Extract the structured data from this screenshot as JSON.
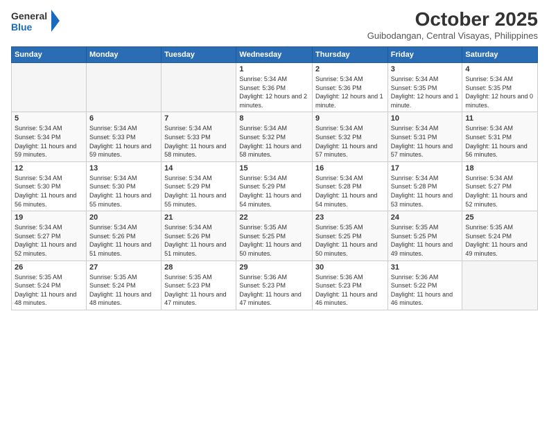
{
  "header": {
    "logo_general": "General",
    "logo_blue": "Blue",
    "month": "October 2025",
    "location": "Guibodangan, Central Visayas, Philippines"
  },
  "weekdays": [
    "Sunday",
    "Monday",
    "Tuesday",
    "Wednesday",
    "Thursday",
    "Friday",
    "Saturday"
  ],
  "weeks": [
    [
      {
        "day": "",
        "info": ""
      },
      {
        "day": "",
        "info": ""
      },
      {
        "day": "",
        "info": ""
      },
      {
        "day": "1",
        "sunrise": "5:34 AM",
        "sunset": "5:36 PM",
        "daylight": "12 hours and 2 minutes."
      },
      {
        "day": "2",
        "sunrise": "5:34 AM",
        "sunset": "5:36 PM",
        "daylight": "12 hours and 1 minute."
      },
      {
        "day": "3",
        "sunrise": "5:34 AM",
        "sunset": "5:35 PM",
        "daylight": "12 hours and 1 minute."
      },
      {
        "day": "4",
        "sunrise": "5:34 AM",
        "sunset": "5:35 PM",
        "daylight": "12 hours and 0 minutes."
      }
    ],
    [
      {
        "day": "5",
        "sunrise": "5:34 AM",
        "sunset": "5:34 PM",
        "daylight": "11 hours and 59 minutes."
      },
      {
        "day": "6",
        "sunrise": "5:34 AM",
        "sunset": "5:33 PM",
        "daylight": "11 hours and 59 minutes."
      },
      {
        "day": "7",
        "sunrise": "5:34 AM",
        "sunset": "5:33 PM",
        "daylight": "11 hours and 58 minutes."
      },
      {
        "day": "8",
        "sunrise": "5:34 AM",
        "sunset": "5:32 PM",
        "daylight": "11 hours and 58 minutes."
      },
      {
        "day": "9",
        "sunrise": "5:34 AM",
        "sunset": "5:32 PM",
        "daylight": "11 hours and 57 minutes."
      },
      {
        "day": "10",
        "sunrise": "5:34 AM",
        "sunset": "5:31 PM",
        "daylight": "11 hours and 57 minutes."
      },
      {
        "day": "11",
        "sunrise": "5:34 AM",
        "sunset": "5:31 PM",
        "daylight": "11 hours and 56 minutes."
      }
    ],
    [
      {
        "day": "12",
        "sunrise": "5:34 AM",
        "sunset": "5:30 PM",
        "daylight": "11 hours and 56 minutes."
      },
      {
        "day": "13",
        "sunrise": "5:34 AM",
        "sunset": "5:30 PM",
        "daylight": "11 hours and 55 minutes."
      },
      {
        "day": "14",
        "sunrise": "5:34 AM",
        "sunset": "5:29 PM",
        "daylight": "11 hours and 55 minutes."
      },
      {
        "day": "15",
        "sunrise": "5:34 AM",
        "sunset": "5:29 PM",
        "daylight": "11 hours and 54 minutes."
      },
      {
        "day": "16",
        "sunrise": "5:34 AM",
        "sunset": "5:28 PM",
        "daylight": "11 hours and 54 minutes."
      },
      {
        "day": "17",
        "sunrise": "5:34 AM",
        "sunset": "5:28 PM",
        "daylight": "11 hours and 53 minutes."
      },
      {
        "day": "18",
        "sunrise": "5:34 AM",
        "sunset": "5:27 PM",
        "daylight": "11 hours and 52 minutes."
      }
    ],
    [
      {
        "day": "19",
        "sunrise": "5:34 AM",
        "sunset": "5:27 PM",
        "daylight": "11 hours and 52 minutes."
      },
      {
        "day": "20",
        "sunrise": "5:34 AM",
        "sunset": "5:26 PM",
        "daylight": "11 hours and 51 minutes."
      },
      {
        "day": "21",
        "sunrise": "5:34 AM",
        "sunset": "5:26 PM",
        "daylight": "11 hours and 51 minutes."
      },
      {
        "day": "22",
        "sunrise": "5:35 AM",
        "sunset": "5:25 PM",
        "daylight": "11 hours and 50 minutes."
      },
      {
        "day": "23",
        "sunrise": "5:35 AM",
        "sunset": "5:25 PM",
        "daylight": "11 hours and 50 minutes."
      },
      {
        "day": "24",
        "sunrise": "5:35 AM",
        "sunset": "5:25 PM",
        "daylight": "11 hours and 49 minutes."
      },
      {
        "day": "25",
        "sunrise": "5:35 AM",
        "sunset": "5:24 PM",
        "daylight": "11 hours and 49 minutes."
      }
    ],
    [
      {
        "day": "26",
        "sunrise": "5:35 AM",
        "sunset": "5:24 PM",
        "daylight": "11 hours and 48 minutes."
      },
      {
        "day": "27",
        "sunrise": "5:35 AM",
        "sunset": "5:24 PM",
        "daylight": "11 hours and 48 minutes."
      },
      {
        "day": "28",
        "sunrise": "5:35 AM",
        "sunset": "5:23 PM",
        "daylight": "11 hours and 47 minutes."
      },
      {
        "day": "29",
        "sunrise": "5:36 AM",
        "sunset": "5:23 PM",
        "daylight": "11 hours and 47 minutes."
      },
      {
        "day": "30",
        "sunrise": "5:36 AM",
        "sunset": "5:23 PM",
        "daylight": "11 hours and 46 minutes."
      },
      {
        "day": "31",
        "sunrise": "5:36 AM",
        "sunset": "5:22 PM",
        "daylight": "11 hours and 46 minutes."
      },
      {
        "day": "",
        "info": ""
      }
    ]
  ],
  "labels": {
    "sunrise": "Sunrise:",
    "sunset": "Sunset:",
    "daylight": "Daylight hours"
  }
}
